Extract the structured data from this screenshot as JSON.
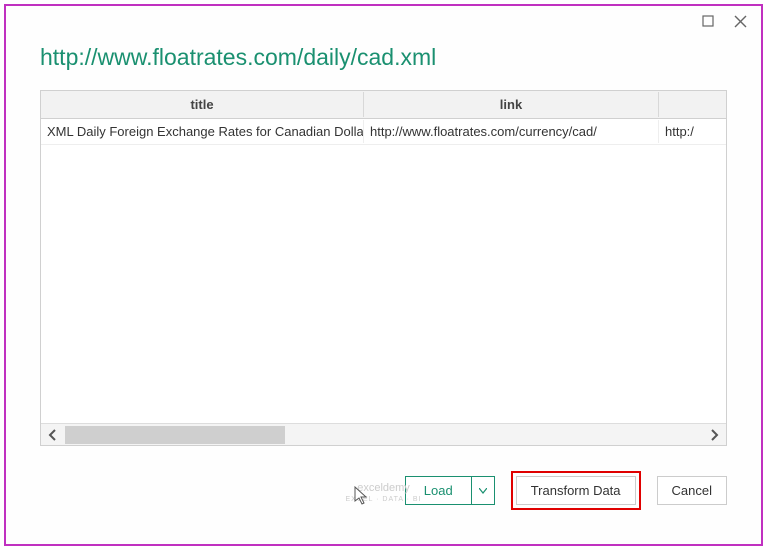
{
  "title": "http://www.floatrates.com/daily/cad.xml",
  "table": {
    "headers": [
      "title",
      "link",
      ""
    ],
    "rows": [
      {
        "c1": "XML Daily Foreign Exchange Rates for Canadian Dollar (...",
        "c2": "http://www.floatrates.com/currency/cad/",
        "c3": "http:/"
      }
    ]
  },
  "buttons": {
    "load": "Load",
    "transform": "Transform Data",
    "cancel": "Cancel"
  },
  "watermark": {
    "line1": "exceldemy",
    "line2": "EXCEL · DATA · BI"
  }
}
